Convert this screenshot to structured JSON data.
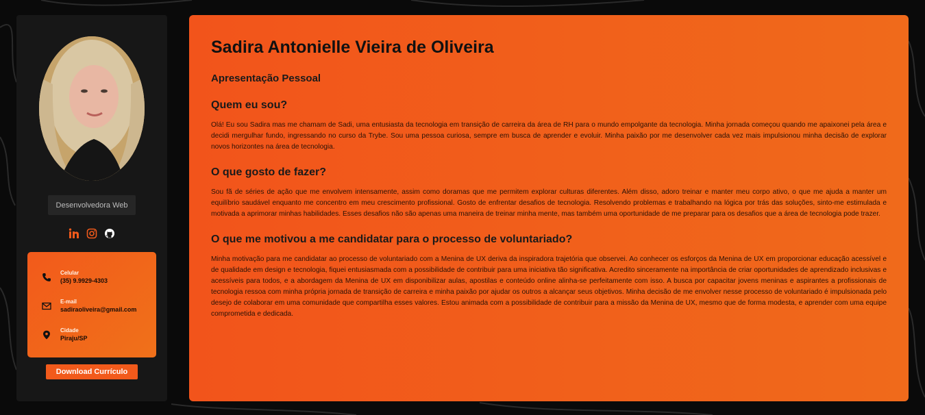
{
  "profile": {
    "role": "Desenvolvedora Web",
    "download_label": "Download Currículo"
  },
  "socials": [
    {
      "icon": "linkedin-icon",
      "color": "#f25a1b"
    },
    {
      "icon": "instagram-icon",
      "color": "#f25a1b"
    },
    {
      "icon": "github-icon",
      "color": "#ffffff"
    }
  ],
  "contacts": {
    "phone": {
      "label": "Celular",
      "value": "(35) 9.9929-4303"
    },
    "email": {
      "label": "E-mail",
      "value": "sadiraoliveira@gmail.com"
    },
    "city": {
      "label": "Cidade",
      "value": "Piraju/SP"
    }
  },
  "main": {
    "name": "Sadira Antonielle Vieira de Oliveira",
    "section": "Apresentação Pessoal",
    "blocks": [
      {
        "title": "Quem eu sou?",
        "text": "Olá! Eu sou Sadira mas me chamam de Sadi, uma entusiasta da tecnologia em transição de carreira da área de RH para o mundo empolgante da tecnologia. Minha jornada começou quando me apaixonei pela área e decidi mergulhar fundo, ingressando no curso da Trybe. Sou uma pessoa curiosa, sempre em busca de aprender e evoluir. Minha paixão por me desenvolver cada vez mais impulsionou minha decisão de explorar novos horizontes na área de tecnologia."
      },
      {
        "title": "O que gosto de fazer?",
        "text": "Sou fã de séries de ação que me envolvem intensamente, assim como doramas que me permitem explorar culturas diferentes. Além disso, adoro treinar e manter meu corpo ativo, o que me ajuda a manter um equilíbrio saudável enquanto me concentro em meu crescimento profissional. Gosto de enfrentar desafios de tecnologia. Resolvendo problemas e trabalhando na lógica por trás das soluções, sinto-me estimulada e motivada a aprimorar minhas habilidades. Esses desafios não são apenas uma maneira de treinar minha mente, mas também uma oportunidade de me preparar para os desafios que a área de tecnologia pode trazer."
      },
      {
        "title": "O que me motivou a me candidatar para o processo de voluntariado?",
        "text": "Minha motivação para me candidatar ao processo de voluntariado com a Menina de UX deriva da inspiradora trajetória que observei. Ao conhecer os esforços da Menina de UX em proporcionar educação acessível e de qualidade em design e tecnologia, fiquei entusiasmada com a possibilidade de contribuir para uma iniciativa tão significativa. Acredito sinceramente na importância de criar oportunidades de aprendizado inclusivas e acessíveis para todos, e a abordagem da Menina de UX em disponibilizar aulas, apostilas e conteúdo online alinha-se perfeitamente com isso. A busca por capacitar jovens meninas e aspirantes a profissionais de tecnologia ressoa com minha própria jornada de transição de carreira e minha paixão por ajudar os outros a alcançar seus objetivos. Minha decisão de me envolver nesse processo de voluntariado é impulsionada pelo desejo de colaborar em uma comunidade que compartilha esses valores. Estou animada com a possibilidade de contribuir para a missão da Menina de UX, mesmo que de forma modesta, e aprender com uma equipe comprometida e dedicada."
      }
    ]
  },
  "colors": {
    "accent": "#f25a1b",
    "sidebar": "#171717",
    "background": "#0a0a0a"
  }
}
